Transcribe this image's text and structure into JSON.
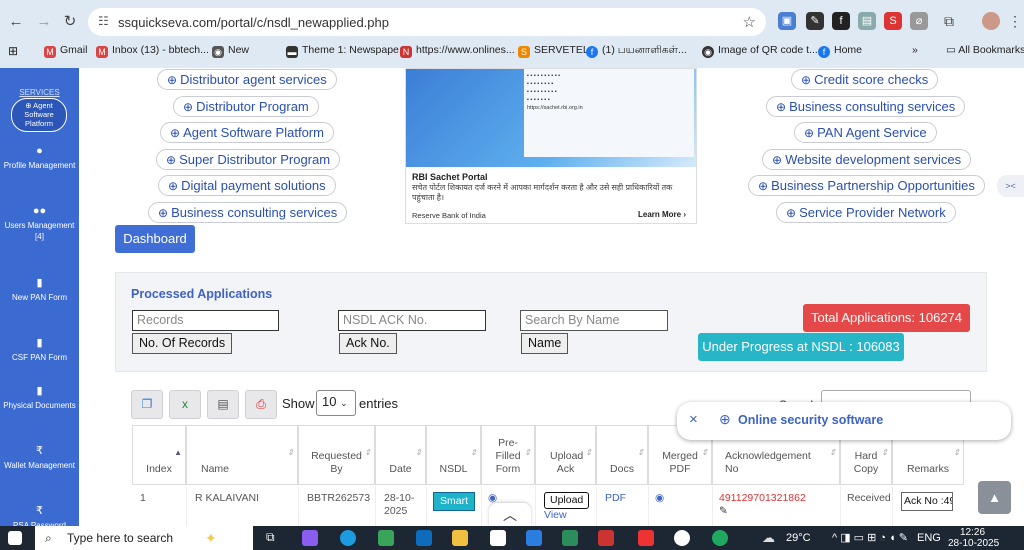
{
  "browser": {
    "url": "ssquickseva.com/portal/c/nsdl_newapplied.php",
    "bookmarks": [
      "Gmail",
      "Inbox (13) - bbtech...",
      "New",
      "Theme 1: Newspape...",
      "https://www.onlines...",
      "SERVETEL",
      "(1) பயனாளிகள்...",
      "Image of QR code t...",
      "Home"
    ],
    "all_bookmarks": "All Bookmarks",
    "more": "»"
  },
  "sidebar": {
    "services_label": "SERVICES",
    "active": "Agent Software Platform",
    "items": [
      "Profile Management",
      "Users Management [4]",
      "New PAN Form",
      "CSF PAN Form",
      "Physical Documents",
      "Wallet Management",
      "PSA Password"
    ]
  },
  "services_left": [
    "Distributor agent services",
    "Distributor Program",
    "Agent Software Platform",
    "Super Distributor Program",
    "Digital payment solutions",
    "Business consulting services"
  ],
  "services_right": [
    "Credit score checks",
    "Business consulting services",
    "PAN Agent Service",
    "Website development services",
    "Business Partnership Opportunities",
    "Service Provider Network"
  ],
  "banner": {
    "title": "RBI Sachet Portal",
    "subtitle": "सचेत पोर्टल शिकायत दर्ज करने में आपका मार्गदर्शन करता है और उसे सही प्राधिकारियों तक पहुंचाता है।",
    "source": "Reserve Bank of India",
    "cta": "Learn More"
  },
  "dashboard_button": "Dashboard",
  "processed": {
    "title": "Processed Applications",
    "records_placeholder": "Records",
    "records_button": "No. Of Records",
    "ack_placeholder": "NSDL ACK No.",
    "ack_button": "Ack No.",
    "name_placeholder": "Search By Name",
    "name_button": "Name",
    "total": "Total Applications: 106274",
    "under_progress": "Under Progress at NSDL : 106083"
  },
  "table_controls": {
    "show": "Show",
    "entries_value": "10",
    "entries": "entries",
    "search": "Search:"
  },
  "toast": {
    "label": "Online security software",
    "close": "×",
    "plus": "⊕"
  },
  "table": {
    "headers": [
      "Index",
      "Name",
      "Requested By",
      "Date",
      "NSDL",
      "Pre-Filled Form",
      "Upload Ack",
      "Docs",
      "Merged PDF",
      "Acknowledgement No",
      "Hard Copy",
      "Remarks"
    ],
    "row": {
      "index": "1",
      "name": "R KALAIVANI",
      "requested_by": "BBTR262573",
      "date": "28-10-2025",
      "nsdl": "Smart",
      "upload": "Upload",
      "view": "View",
      "docs": "PDF",
      "ack": "491129701321862",
      "hard_copy": "Received",
      "remarks": "Ack No :49"
    }
  },
  "taskbar": {
    "search": "Type here to search",
    "weather": "29°C",
    "lang": "ENG",
    "time": "12:26",
    "date": "28-10-2025"
  }
}
